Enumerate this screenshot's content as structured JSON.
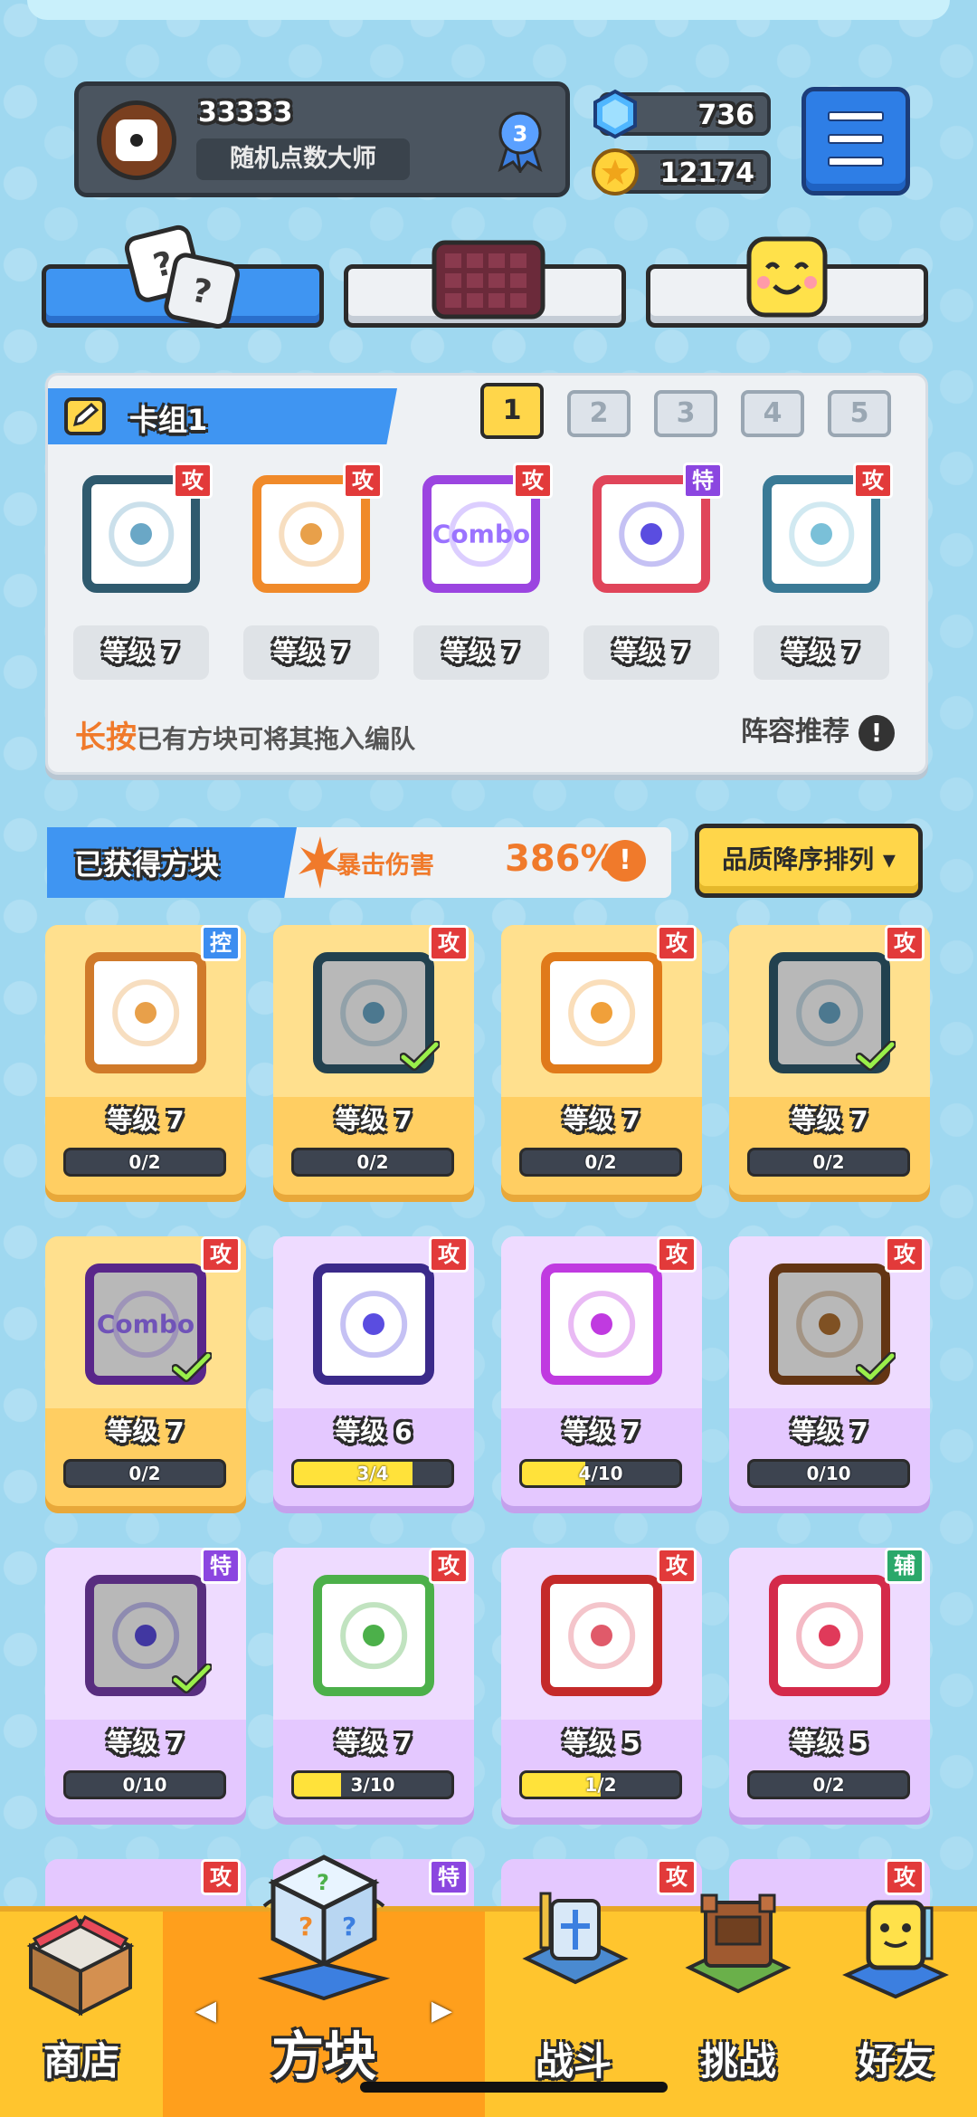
{
  "profile": {
    "id": "33333",
    "title": "随机点数大师",
    "rank": "3"
  },
  "currency": {
    "gems": "736",
    "coins": "12174"
  },
  "deck": {
    "title": "卡组1",
    "slots": [
      "1",
      "2",
      "3",
      "4",
      "5"
    ],
    "active_slot": "1",
    "cards": [
      {
        "tag": "攻",
        "level": "等级 7",
        "color": "#2f5a6e",
        "pip": "#6aa7c6"
      },
      {
        "tag": "攻",
        "level": "等级 7",
        "color": "#f08a2a",
        "pip": "#e8a04a"
      },
      {
        "tag": "攻",
        "level": "等级 7",
        "color": "#9b45e0",
        "pip": "#9b73ff",
        "text": "Combo"
      },
      {
        "tag": "特",
        "level": "等级 7",
        "color": "#e0455a",
        "pip": "#5a4de0"
      },
      {
        "tag": "攻",
        "level": "等级 7",
        "color": "#3a7a96",
        "pip": "#7ac0d8"
      }
    ],
    "hint_strong": "长按",
    "hint_rest": "已有方块可将其拖入编队",
    "recommend": "阵容推荐",
    "info": "!"
  },
  "obtained": {
    "title": "已获得方块",
    "crit_label": "暴击伤害",
    "crit_value": "386%",
    "crit_info": "!",
    "sort_label": "品质降序排列 ▾"
  },
  "cards": [
    {
      "tier": "gold",
      "tag": "控",
      "tag_type": "ctl",
      "level": "等级 7",
      "progress": "0/2",
      "fill": 0,
      "color": "#d07a2a",
      "pip": "#e8a04a",
      "checked": false,
      "dark": false
    },
    {
      "tier": "gold",
      "tag": "攻",
      "tag_type": "atk",
      "level": "等级 7",
      "progress": "0/2",
      "fill": 0,
      "color": "#2f5a6e",
      "pip": "#6aa7c6",
      "checked": true,
      "dark": true
    },
    {
      "tier": "gold",
      "tag": "攻",
      "tag_type": "atk",
      "level": "等级 7",
      "progress": "0/2",
      "fill": 0,
      "color": "#e07a1a",
      "pip": "#f0a03a",
      "checked": false,
      "dark": false
    },
    {
      "tier": "gold",
      "tag": "攻",
      "tag_type": "atk",
      "level": "等级 7",
      "progress": "0/2",
      "fill": 0,
      "color": "#2f5a6e",
      "pip": "#6aa7c6",
      "checked": true,
      "dark": true
    },
    {
      "tier": "gold",
      "tag": "攻",
      "tag_type": "atk",
      "level": "等级 7",
      "progress": "0/2",
      "fill": 0,
      "color": "#7b35c0",
      "pip": "#9b73ff",
      "checked": true,
      "dark": true,
      "text": "Combo"
    },
    {
      "tier": "purple",
      "tag": "攻",
      "tag_type": "atk",
      "level": "等级 6",
      "progress": "3/4",
      "fill": 0.75,
      "color": "#3b2a8a",
      "pip": "#5a4de0",
      "checked": false,
      "dark": false
    },
    {
      "tier": "purple",
      "tag": "攻",
      "tag_type": "atk",
      "level": "等级 7",
      "progress": "4/10",
      "fill": 0.4,
      "color": "#c03ae0",
      "pip": "#c03ae0",
      "checked": false,
      "dark": false
    },
    {
      "tier": "purple",
      "tag": "攻",
      "tag_type": "atk",
      "level": "等级 7",
      "progress": "0/10",
      "fill": 0,
      "color": "#8a4a1a",
      "pip": "#b07030",
      "checked": true,
      "dark": true
    },
    {
      "tier": "purple",
      "tag": "特",
      "tag_type": "spe",
      "level": "等级 7",
      "progress": "0/10",
      "fill": 0,
      "color": "#7a3fb0",
      "pip": "#5a4de0",
      "checked": true,
      "dark": true
    },
    {
      "tier": "purple",
      "tag": "攻",
      "tag_type": "atk",
      "level": "等级 7",
      "progress": "3/10",
      "fill": 0.3,
      "color": "#4cb04a",
      "pip": "#4cb04a",
      "checked": false,
      "dark": false
    },
    {
      "tier": "purple",
      "tag": "攻",
      "tag_type": "atk",
      "level": "等级 5",
      "progress": "1/2",
      "fill": 0.5,
      "color": "#c42a2a",
      "pip": "#e05a6a",
      "checked": false,
      "dark": false
    },
    {
      "tier": "purple",
      "tag": "辅",
      "tag_type": "sup",
      "level": "等级 5",
      "progress": "0/2",
      "fill": 0,
      "color": "#d42a4a",
      "pip": "#e03a5a",
      "checked": false,
      "dark": false
    }
  ],
  "peek_cards": [
    {
      "tag": "攻",
      "tag_type": "atk"
    },
    {
      "tag": "特",
      "tag_type": "spe"
    },
    {
      "tag": "攻",
      "tag_type": "atk"
    },
    {
      "tag": "攻",
      "tag_type": "atk"
    }
  ],
  "nav": {
    "shop": "商店",
    "dice": "方块",
    "battle": "战斗",
    "challenge": "挑战",
    "friends": "好友",
    "arrow_left": "◀",
    "arrow_right": "▶"
  }
}
